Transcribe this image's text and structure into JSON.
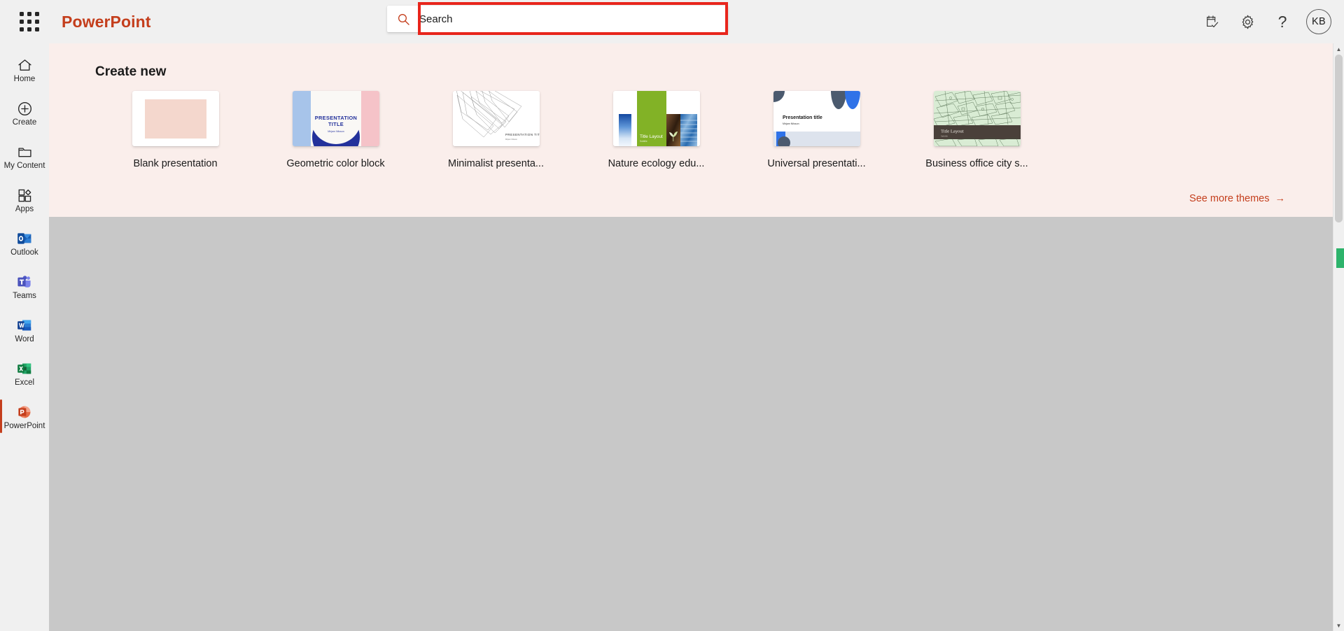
{
  "app": {
    "brand": "PowerPoint",
    "waffle_icon": "app-launcher-grid-icon"
  },
  "search": {
    "placeholder": "Search",
    "value": "",
    "icon": "search-icon",
    "highlighted": true,
    "highlight_color": "#e8251c"
  },
  "topbar_actions": [
    {
      "name": "notes-check-icon",
      "label": ""
    },
    {
      "name": "gear-icon",
      "label": ""
    },
    {
      "name": "help-question-icon",
      "label": "?"
    }
  ],
  "account": {
    "initials": "KB"
  },
  "sidebar": {
    "items": [
      {
        "label": "Home",
        "icon": "home-icon",
        "selected": false
      },
      {
        "label": "Create",
        "icon": "plus-circle-icon",
        "selected": false
      },
      {
        "label": "My Content",
        "icon": "folder-icon",
        "selected": false
      },
      {
        "label": "Apps",
        "icon": "apps-grid-icon",
        "selected": false
      },
      {
        "label": "Outlook",
        "icon": "outlook-icon",
        "selected": false
      },
      {
        "label": "Teams",
        "icon": "teams-icon",
        "selected": false
      },
      {
        "label": "Word",
        "icon": "word-icon",
        "selected": false
      },
      {
        "label": "Excel",
        "icon": "excel-icon",
        "selected": false
      },
      {
        "label": "PowerPoint",
        "icon": "powerpoint-icon",
        "selected": true
      }
    ]
  },
  "create_new": {
    "heading": "Create new",
    "see_more": "See more themes",
    "see_more_arrow": "→",
    "templates": [
      {
        "label": "Blank presentation",
        "kind": "blank"
      },
      {
        "label": "Geometric color block",
        "kind": "geometric",
        "title": "PRESENTATION TITLE",
        "author": "Mirjam Nilsson"
      },
      {
        "label": "Minimalist presenta...",
        "kind": "minimalist",
        "title": "PRESENTATION TITLE",
        "author": "Mirjam Nilsson"
      },
      {
        "label": "Nature ecology edu...",
        "kind": "nature",
        "title": "Title Layout",
        "author": "Subtitle"
      },
      {
        "label": "Universal presentati...",
        "kind": "universal",
        "title": "Presentation title",
        "author": "Mirjam Nilsson"
      },
      {
        "label": "Business office city s...",
        "kind": "business",
        "title": "Title Layout",
        "author": "Subtitle"
      }
    ]
  },
  "theme": {
    "brand_color": "#c43e1c",
    "panel_background": "#faeeeb",
    "content_background": "#c8c8c8",
    "chrome_background": "#f0f0f0"
  }
}
